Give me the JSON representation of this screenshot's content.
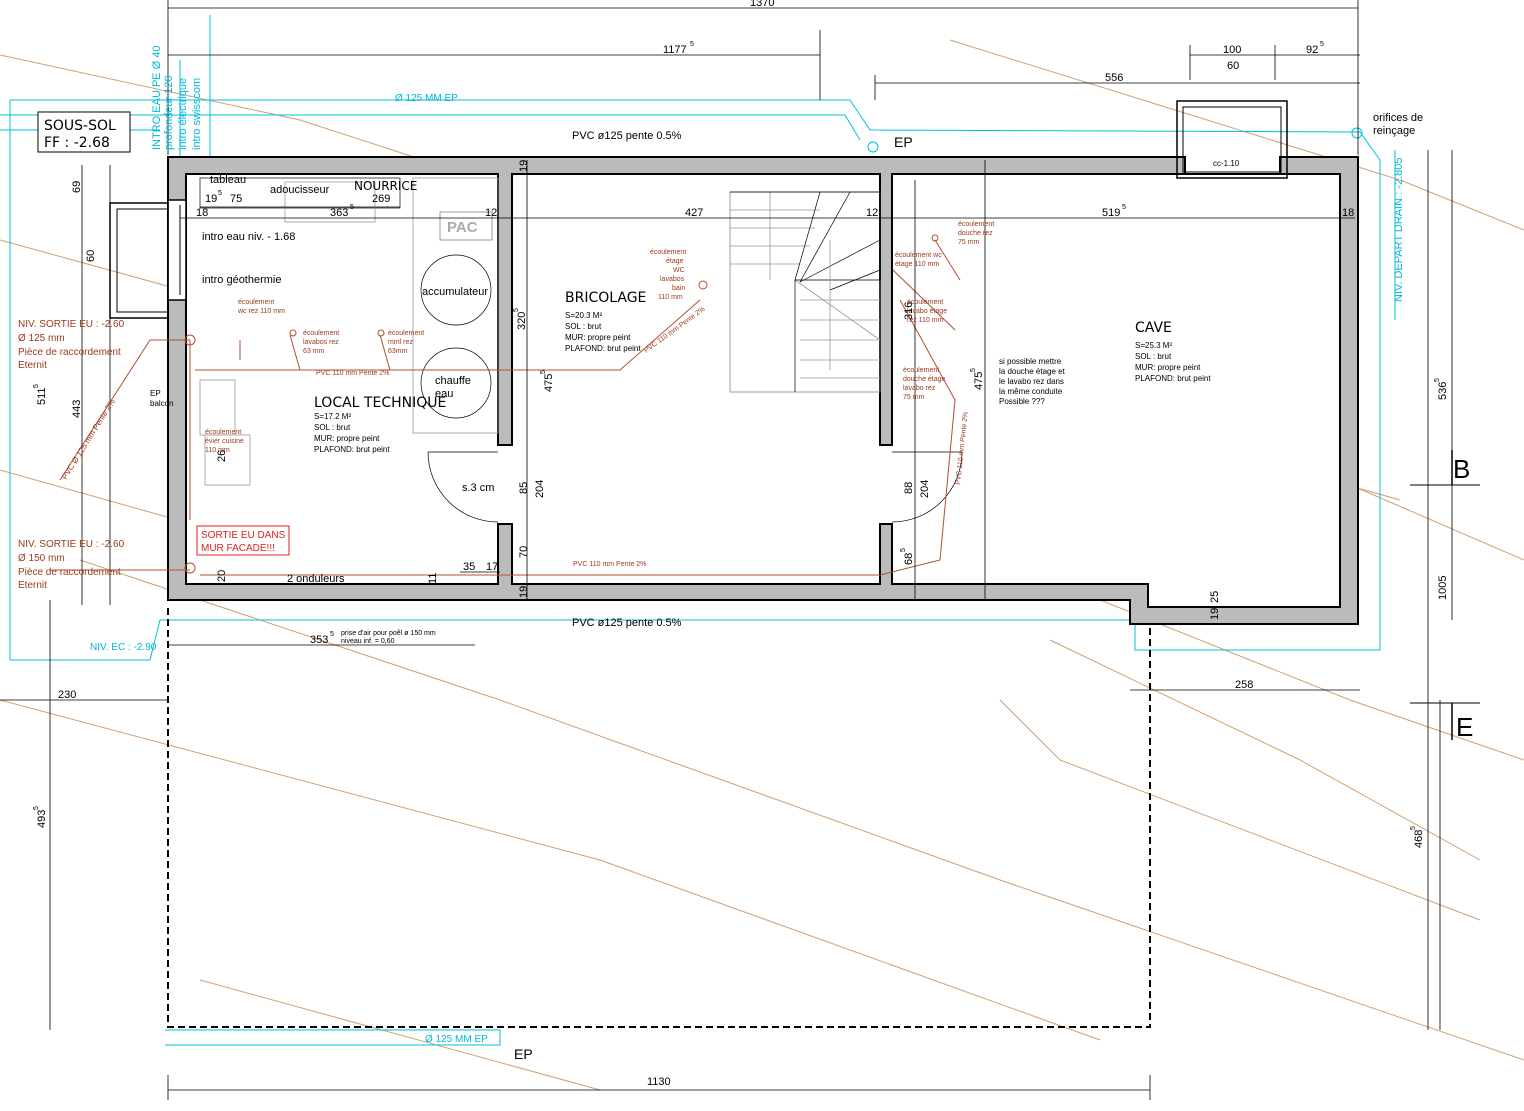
{
  "level": {
    "name": "SOUS-SOL",
    "ff": "FF : -2.68"
  },
  "rooms": {
    "local_technique": {
      "title": "LOCAL TECHNIQUE",
      "area": "S=17.2 M²",
      "sol": "SOL : brut",
      "mur": "MUR: propre peint",
      "plafond": "PLAFOND: brut peint"
    },
    "bricolage": {
      "title": "BRICOLAGE",
      "area": "S=20.3 M²",
      "sol": "SOL : brut",
      "mur": "MUR: propre peint",
      "plafond": "PLAFOND: brut peint"
    },
    "cave": {
      "title": "CAVE",
      "area": "S=25.3 M²",
      "sol": "SOL : brut",
      "mur": "MUR: propre peint",
      "plafond": "PLAFOND: brut peint"
    }
  },
  "equipment": {
    "tableau": "tableau",
    "adoucisseur": "adoucisseur",
    "nourrice": "NOURRICE",
    "pac": "PAC",
    "accumulateur": "accumulateur",
    "chauffe1": "chauffe",
    "chauffe2": "eau",
    "intro_eau": "intro eau niv. - 1.68",
    "intro_geo": "intro géothermie",
    "ep_balcon1": "EP",
    "ep_balcon2": "balcon",
    "onduleurs": "2 onduleurs",
    "s3cm": "s.3 cm",
    "orifices1": "orifices de",
    "orifices2": "reinçage",
    "cc": "cc-1.10"
  },
  "pipes": {
    "ep_top": "Ø 125 MM EP",
    "ep_bottom": "Ø 125 MM EP",
    "pvc_top": "PVC ø125 pente 0.5%",
    "pvc_bottom": "PVC ø125 pente 0.5%",
    "ep_label_top": "EP",
    "ep_label_bottom": "EP",
    "intro_vertical": [
      "INTRO EAU PE Ø 40",
      "profondeur 120",
      "intro électrique",
      "intro swisscom"
    ],
    "niv_ec": "NIV. EC : -2.90",
    "niv_drain": "NIV. DEPART DRAIN : -2.805",
    "pvc110_tech": "PVC 110 mm Pente 2%",
    "pvc110_bottom": "PVC 110 mm Pente 2%",
    "pvc110_diag": "PVC 110 mm Pente 2%",
    "pvc110_vert": "PVC 110 mm Pente 2%",
    "pvc125_diag": "PVC Ø 125 mm Pente 2%",
    "sortie1": [
      "NIV. SORTIE EU : -2.60",
      "Ø 125 mm",
      "Pièce de raccordement",
      "Eternit"
    ],
    "sortie2": [
      "NIV. SORTIE EU : -2.60",
      "Ø 150 mm",
      "Pièce de raccordement",
      "Eternit"
    ],
    "sortie_mur": [
      "SORTIE EU DANS",
      "MUR   FACADE!!!"
    ],
    "ecoul_wc": [
      "écoulement",
      "wc rez 110 mm"
    ],
    "ecoul_lav": [
      "écoulement",
      "lavabos rez",
      "63 mm"
    ],
    "ecoul_mml": [
      "écoulement",
      "mml rez",
      "63mm"
    ],
    "ecoul_evier": [
      "écoulement",
      "évier cuisine",
      "110 mm"
    ],
    "ecoul_bain": [
      "écoulement",
      "étage",
      "WC",
      "lavabos",
      "bain",
      "110 mm"
    ],
    "ecoul_douche_rez": [
      "écoulement",
      "douche rez",
      "75 mm"
    ],
    "ecoul_wc_etage": [
      "écoulement wc",
      "étage 110 mm"
    ],
    "ecoul_lav_etage": [
      "écoulement",
      "lavabo étage",
      "rez 110 mm"
    ],
    "ecoul_douche_etage": [
      "écoulement",
      "douche étage",
      "lavabo rez",
      "75 mm"
    ],
    "prise_air": [
      "prise d'air pour poêl ø 150 mm",
      "niveau inf. = 0,60"
    ]
  },
  "notes": {
    "cave_note": [
      "si possible mettre",
      "la douche étage et",
      "le lavabo rez dans",
      "la même conduite",
      "Possible ???"
    ]
  },
  "section_markers": {
    "b": "B",
    "e": "E"
  },
  "dimensions": {
    "total_top": "1370",
    "d1177": "1177",
    "d1177_sup": "5",
    "d100": "100",
    "d60": "60",
    "d92": "92",
    "d92_sup": "5",
    "d556": "556",
    "d19": "19",
    "d19_sup": "5",
    "d75": "75",
    "d269": "269",
    "d363": "363",
    "d363_sup": "5",
    "d18a": "18",
    "d12a": "12",
    "d427": "427",
    "d12b": "12",
    "d519": "519",
    "d519_sup": "5",
    "d18b": "18",
    "d19v": "19",
    "d69": "69",
    "d60v": "60",
    "d511": "511",
    "d511_sup": "5",
    "d443": "443",
    "d320": "320",
    "d320_sup": "5",
    "d475a": "475",
    "d475a_sup": "5",
    "d85": "85",
    "d204a": "204",
    "d70": "70",
    "d316": "316",
    "d475b": "475",
    "d475b_sup": "5",
    "d88": "88",
    "d204b": "204",
    "d68": "68",
    "d68_sup": "5",
    "d35": "35",
    "d17": "17",
    "d11": "11",
    "d20": "20",
    "d26": "26",
    "d19b": "19",
    "d25": "25",
    "d19c": "19",
    "d536": "536",
    "d536_sup": "5",
    "d1005": "1005",
    "d468": "468",
    "d468_sup": "5",
    "d353": "353",
    "d353_sup": "5",
    "d230": "230",
    "d258": "258",
    "d493": "493",
    "d493_sup": "5",
    "d1130": "1130"
  }
}
